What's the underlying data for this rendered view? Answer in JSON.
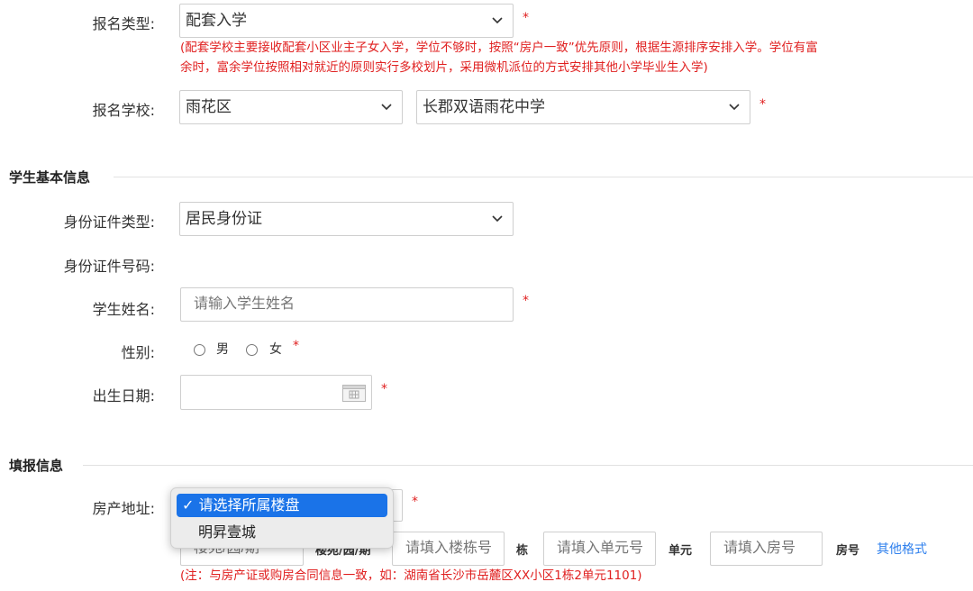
{
  "registration": {
    "type_label": "报名类型:",
    "type_value": "配套入学",
    "required_mark": "*",
    "note_line1": "(配套学校主要接收配套小区业主子女入学，学位不够时，按照“房户一致”优先原则，根据生源排序安排入学。学位有富",
    "note_line2": "余时，富余学位按照相对就近的原则实行多校划片，采用微机派位的方式安排其他小学毕业生入学)",
    "school_label": "报名学校:",
    "district_value": "雨花区",
    "school_value": "长郡双语雨花中学"
  },
  "student": {
    "section_title": "学生基本信息",
    "id_type_label": "身份证件类型:",
    "id_type_value": "居民身份证",
    "id_number_label": "身份证件号码:",
    "name_label": "学生姓名:",
    "name_placeholder": "请输入学生姓名",
    "gender_label": "性别:",
    "gender_male": "男",
    "gender_female": "女",
    "birth_label": "出生日期:"
  },
  "fill": {
    "section_title": "填报信息",
    "address_label": "房产地址:",
    "estate_options": [
      {
        "label": "请选择所属楼盘",
        "selected": true
      },
      {
        "label": "明昇壹城",
        "selected": false
      }
    ],
    "check_mark": "✓",
    "estate_input_placeholder": "楼苑/园/期",
    "building_area_label": "楼苑/园/期",
    "building_placeholder": "请填入楼栋号",
    "building_unit": "栋",
    "unit_placeholder": "请填入单元号",
    "unit_unit": "单元",
    "room_placeholder": "请填入房号",
    "room_unit": "房号",
    "other_format_link": "其他格式",
    "address_note": "(注：与房产证或购房合同信息一致，如：湖南省长沙市岳麓区XX小区1栋2单元1101)"
  },
  "colors": {
    "required": "#e02020",
    "link": "#2f80ed",
    "selected_option": "#1a73e8"
  }
}
